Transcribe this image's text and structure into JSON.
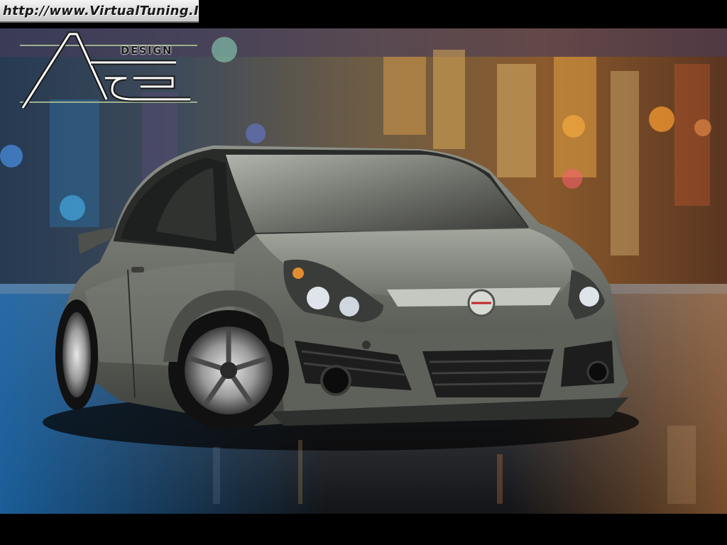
{
  "watermark": {
    "url_text": "http://www.VirtualTuning.IT"
  },
  "logo": {
    "design_text": "DESIGN"
  },
  "image": {
    "subject": "Dark grey tuned hatchback car on wet city street at night",
    "emblem": "opel-emblem-icon"
  },
  "colors": {
    "car_body": "#6b6e66",
    "frame": "#000000",
    "logo_lines": "#9bb08e"
  }
}
